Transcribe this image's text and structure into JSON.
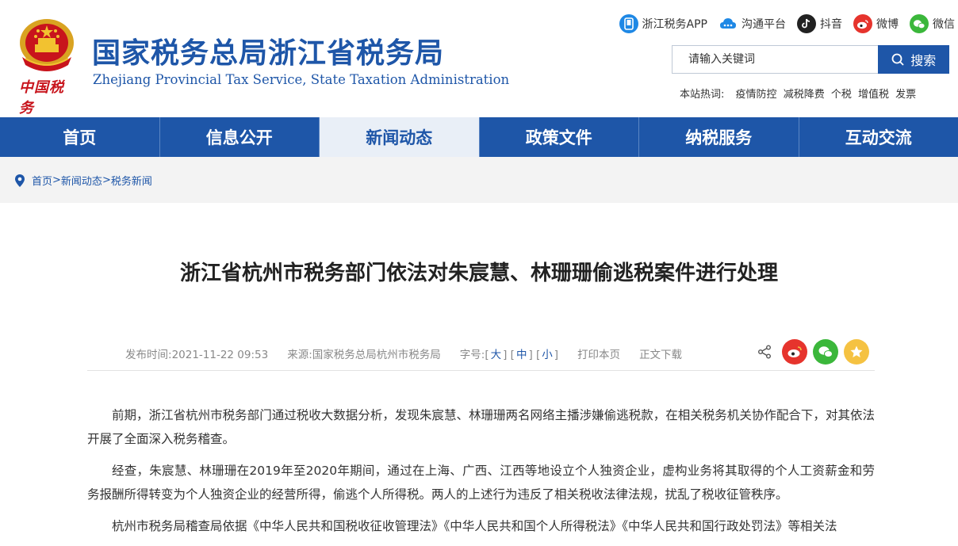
{
  "header": {
    "title": "国家税务总局浙江省税务局",
    "subtitle": "Zhejiang Provincial Tax Service, State Taxation Administration",
    "seal_text": "中国税务"
  },
  "social": [
    {
      "label": "浙江税务APP",
      "icon": "phone-app-icon",
      "color": "#1e88e5"
    },
    {
      "label": "沟通平台",
      "icon": "cloud-chat-icon",
      "color": "#1e88e5"
    },
    {
      "label": "抖音",
      "icon": "douyin-icon",
      "color": "#222222"
    },
    {
      "label": "微博",
      "icon": "weibo-icon",
      "color": "#e6342d"
    },
    {
      "label": "微信",
      "icon": "wechat-icon",
      "color": "#3bb73b"
    }
  ],
  "search": {
    "placeholder": "请输入关键词",
    "button": "搜索"
  },
  "hot": {
    "label": "本站热词:",
    "words": [
      "疫情防控",
      "减税降费",
      "个税",
      "增值税",
      "发票"
    ]
  },
  "nav": {
    "tabs": [
      "首页",
      "信息公开",
      "新闻动态",
      "政策文件",
      "纳税服务",
      "互动交流"
    ],
    "active_index": 2
  },
  "breadcrumb": {
    "items": [
      "首页",
      "新闻动态",
      "税务新闻"
    ],
    "separator": ">"
  },
  "article": {
    "title": "浙江省杭州市税务部门依法对朱宸慧、林珊珊偷逃税案件进行处理",
    "publish_label": "发布时间:",
    "publish_time": "2021-11-22  09:53",
    "source_label": "来源:",
    "source": "国家税务总局杭州市税务局",
    "fontsize_label": "字号:",
    "fontsize_large": "大",
    "fontsize_medium": "中",
    "fontsize_small": "小",
    "print": "打印本页",
    "download": "正文下载",
    "paragraphs": [
      "前期，浙江省杭州市税务部门通过税收大数据分析，发现朱宸慧、林珊珊两名网络主播涉嫌偷逃税款，在相关税务机关协作配合下，对其依法开展了全面深入税务稽查。",
      "经查，朱宸慧、林珊珊在2019年至2020年期间，通过在上海、广西、江西等地设立个人独资企业，虚构业务将其取得的个人工资薪金和劳务报酬所得转变为个人独资企业的经营所得，偷逃个人所得税。两人的上述行为违反了相关税收法律法规，扰乱了税收征管秩序。",
      "杭州市税务局稽查局依据《中华人民共和国税收征收管理法》《中华人民共和国个人所得税法》《中华人民共和国行政处罚法》等相关法"
    ]
  },
  "colors": {
    "brand": "#1e56a8",
    "nav_active_bg": "#e9eff7",
    "share_weibo": "#e6342d",
    "share_wechat": "#3bb73b",
    "share_favorite": "#f5c242"
  }
}
